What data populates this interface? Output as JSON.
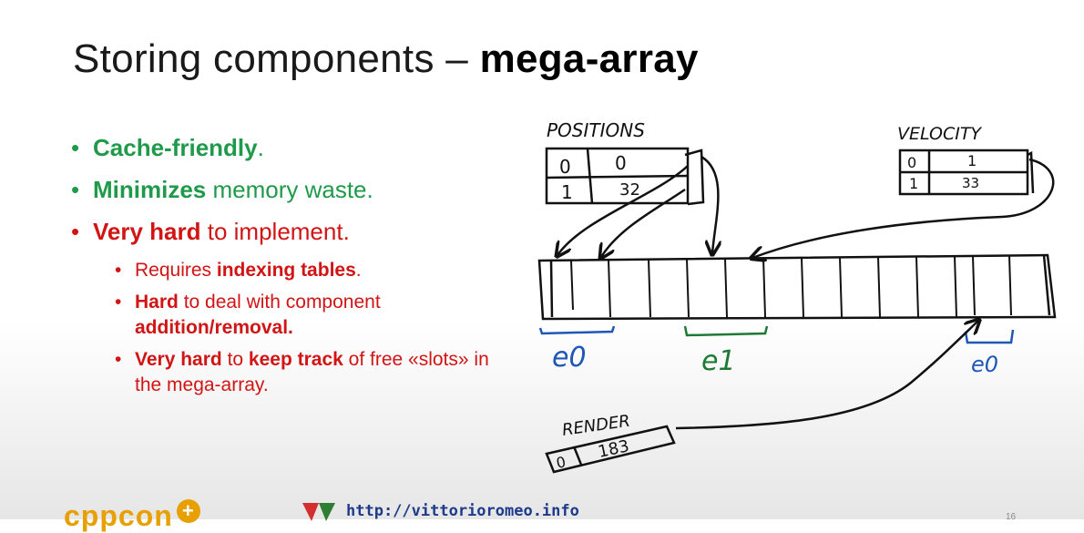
{
  "slide": {
    "title_prefix": "Storing components – ",
    "title_bold": "mega-array",
    "bullets": {
      "b1_strong": "Cache-friendly",
      "b1_rest": ".",
      "b2_strong": "Minimizes",
      "b2_rest": " memory waste.",
      "b3_strong": "Very hard",
      "b3_rest": " to implement.",
      "sub1_pre": "Requires ",
      "sub1_strong": "indexing tables",
      "sub1_post": ".",
      "sub2_strong": "Hard",
      "sub2_mid": " to deal with component ",
      "sub2_strong2": "addition/removal.",
      "sub3_strong": "Very hard",
      "sub3_mid": " to ",
      "sub3_strong2": "keep track",
      "sub3_post": " of free «slots» in the mega-array."
    },
    "bullet_glyph": "•"
  },
  "sketch": {
    "positions_label": "POSITIONS",
    "positions_rows": [
      [
        "0",
        "0"
      ],
      [
        "1",
        "32"
      ]
    ],
    "velocity_label": "VELOCITY",
    "velocity_rows": [
      [
        "0",
        "1"
      ],
      [
        "1",
        "33"
      ]
    ],
    "render_label": "RENDER",
    "render_row": [
      "0",
      "183"
    ],
    "groups": [
      "e0",
      "e1",
      "e0"
    ],
    "colors": {
      "ink": "#111111",
      "blue": "#1f57b8",
      "green": "#1d7a35"
    }
  },
  "footer": {
    "logo_text": "cppcon",
    "logo_plus": "+",
    "url": "http://vittorioromeo.info",
    "page_number": "16"
  }
}
